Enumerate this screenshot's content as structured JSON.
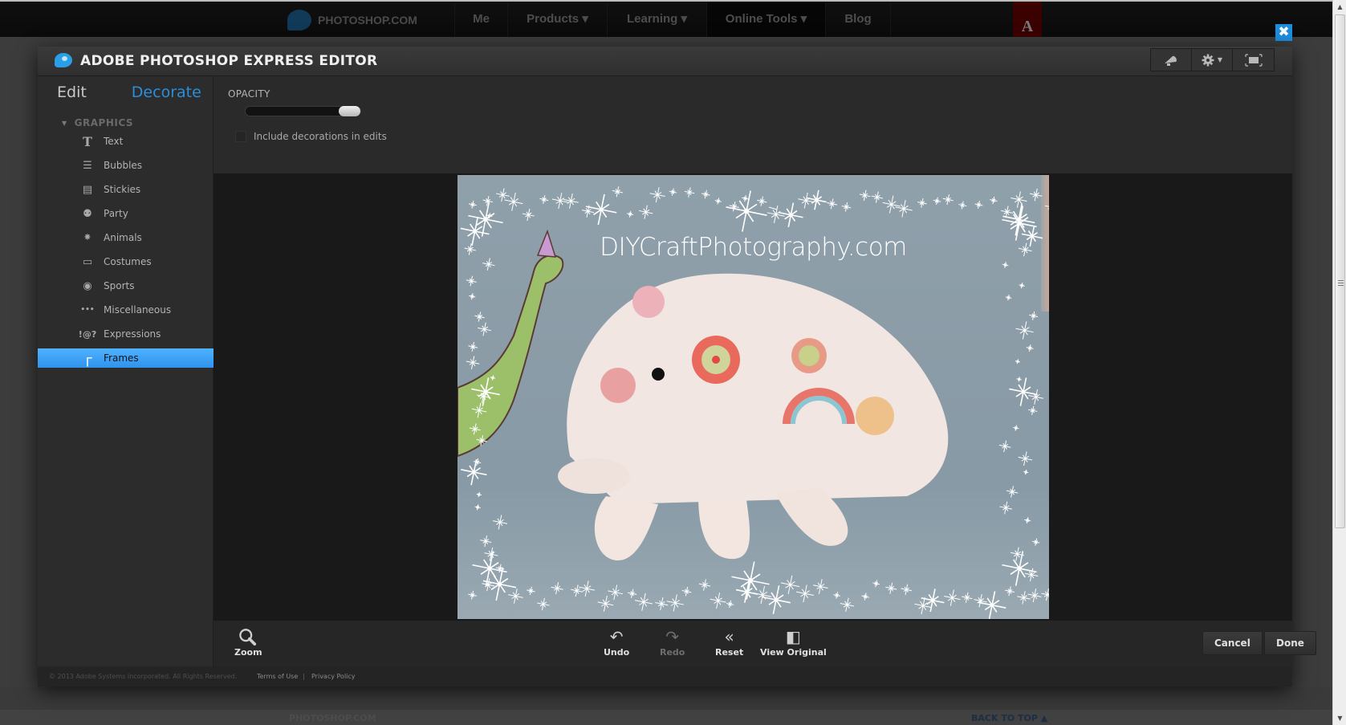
{
  "site_nav": {
    "brand": "PHOTOSHOP.COM",
    "items": [
      {
        "label": "Me",
        "active": false
      },
      {
        "label": "Products ▾",
        "active": false
      },
      {
        "label": "Learning ▾",
        "active": false
      },
      {
        "label": "Online Tools ▾",
        "active": true
      },
      {
        "label": "Blog",
        "active": false
      }
    ],
    "adobe_logo": "A"
  },
  "bg_footer": {
    "brand": "PHOTOSHOP.COM",
    "back_to_top": "BACK TO TOP ▲"
  },
  "close_button": {
    "icon": "close-icon",
    "glyph": "✖"
  },
  "editor": {
    "title": "ADOBE PHOTOSHOP EXPRESS EDITOR",
    "toolbar_buttons": [
      {
        "name": "announce",
        "icon": "megaphone-icon"
      },
      {
        "name": "settings",
        "icon": "gear-icon"
      },
      {
        "name": "fullscreen",
        "icon": "fullscreen-icon"
      }
    ],
    "mode_tabs": [
      {
        "label": "Edit",
        "active": false
      },
      {
        "label": "Decorate",
        "active": true
      }
    ],
    "section": "GRAPHICS",
    "categories": [
      {
        "label": "Text",
        "icon": "text-icon",
        "glyph": "T",
        "selected": false
      },
      {
        "label": "Bubbles",
        "icon": "speech-bubble-icon",
        "glyph": "☰",
        "selected": false
      },
      {
        "label": "Stickies",
        "icon": "sticky-note-icon",
        "glyph": "▤",
        "selected": false
      },
      {
        "label": "Party",
        "icon": "balloon-icon",
        "glyph": "⚉",
        "selected": false
      },
      {
        "label": "Animals",
        "icon": "paw-icon",
        "glyph": "⁕",
        "selected": false
      },
      {
        "label": "Costumes",
        "icon": "mask-icon",
        "glyph": "▭",
        "selected": false
      },
      {
        "label": "Sports",
        "icon": "soccer-ball-icon",
        "glyph": "◉",
        "selected": false
      },
      {
        "label": "Miscellaneous",
        "icon": "dots-icon",
        "glyph": "•••",
        "selected": false
      },
      {
        "label": "Expressions",
        "icon": "expressions-icon",
        "glyph": "!@?",
        "selected": false
      },
      {
        "label": "Frames",
        "icon": "frame-icon",
        "glyph": "┌",
        "selected": true
      }
    ],
    "options": {
      "opacity_label": "OPACITY",
      "opacity_value_percent": 100,
      "include_decorations_label": "Include decorations in edits",
      "include_decorations_checked": false
    },
    "canvas": {
      "watermark": "DIYCraftPhotography.com",
      "frame": "sparkle",
      "colors": {
        "background": "#8b9ca7",
        "plush": "#f2e6e2",
        "dino": "#9cc06a"
      }
    },
    "bottom_tools": [
      {
        "label": "Zoom",
        "icon": "magnifier-icon",
        "glyph": "⌕",
        "enabled": true
      },
      {
        "label": "Undo",
        "icon": "undo-icon",
        "glyph": "↶",
        "enabled": true
      },
      {
        "label": "Redo",
        "icon": "redo-icon",
        "glyph": "↷",
        "enabled": false
      },
      {
        "label": "Reset",
        "icon": "reset-icon",
        "glyph": "«",
        "enabled": true
      },
      {
        "label": "View Original",
        "icon": "view-original-icon",
        "glyph": "◧",
        "enabled": true
      }
    ],
    "actions": {
      "cancel": "Cancel",
      "done": "Done"
    },
    "footer": {
      "copyright": "© 2013 Adobe Systems Incorporated. All Rights Reserved.",
      "terms": "Terms of Use",
      "separator": "|",
      "privacy": "Privacy Policy"
    }
  },
  "colors": {
    "accent": "#2a8fd8",
    "selected_row": "#3aa2f5",
    "close_button": "#1b8fe0"
  }
}
